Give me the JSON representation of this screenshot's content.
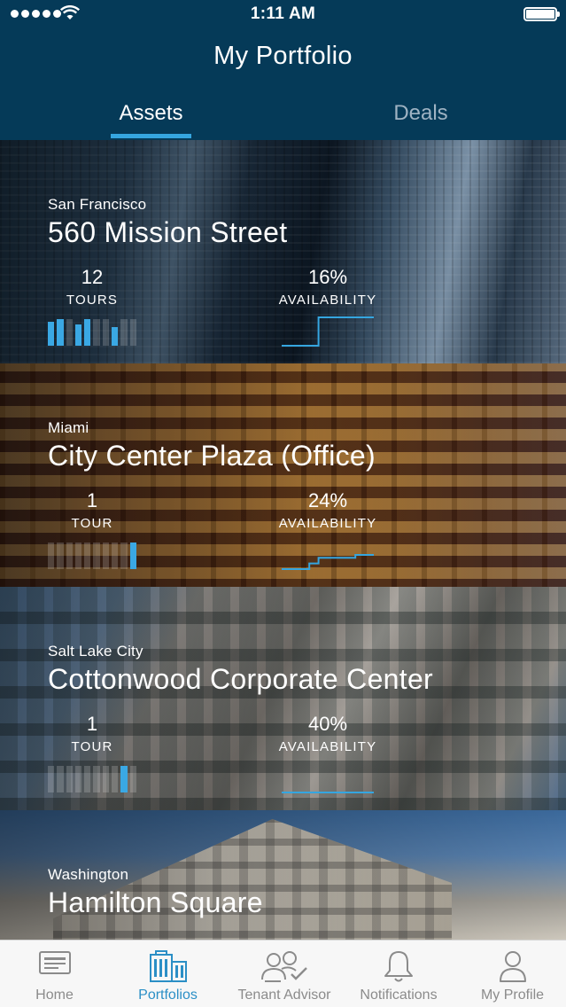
{
  "status_bar": {
    "time": "1:11 AM"
  },
  "header": {
    "title": "My Portfolio"
  },
  "tabs": [
    {
      "label": "Assets",
      "selected": true
    },
    {
      "label": "Deals",
      "selected": false
    }
  ],
  "properties": [
    {
      "city": "San Francisco",
      "name": "560 Mission Street",
      "tours": "12",
      "tours_label": "TOURS",
      "availability": "16%",
      "availability_label": "AVAILABILITY",
      "tour_bars": [
        0.9,
        1,
        0,
        0.8,
        1,
        0,
        0,
        0.7,
        0,
        0
      ],
      "availability_trend": [
        0,
        0,
        0,
        0,
        1,
        1,
        1,
        1,
        1,
        1
      ]
    },
    {
      "city": "Miami",
      "name": "City Center Plaza (Office)",
      "tours": "1",
      "tours_label": "TOUR",
      "availability": "24%",
      "availability_label": "AVAILABILITY",
      "tour_bars": [
        0,
        0,
        0,
        0,
        0,
        0,
        0,
        0,
        0,
        1
      ],
      "availability_trend": [
        0,
        0,
        0,
        0.2,
        0.4,
        0.4,
        0.4,
        0.4,
        0.5,
        0.5
      ]
    },
    {
      "city": "Salt Lake City",
      "name": "Cottonwood Corporate Center",
      "tours": "1",
      "tours_label": "TOUR",
      "availability": "40%",
      "availability_label": "AVAILABILITY",
      "tour_bars": [
        0,
        0,
        0,
        0,
        0,
        0,
        0,
        0,
        1,
        0
      ],
      "availability_trend": [
        0,
        0,
        0,
        0,
        0,
        0,
        0,
        0,
        0,
        0
      ]
    },
    {
      "city": "Washington",
      "name": "Hamilton Square"
    }
  ],
  "tabbar": [
    {
      "label": "Home",
      "icon": "home-icon",
      "active": false
    },
    {
      "label": "Portfolios",
      "icon": "building-icon",
      "active": true
    },
    {
      "label": "Tenant Advisor",
      "icon": "people-check-icon",
      "active": false
    },
    {
      "label": "Notifications",
      "icon": "bell-icon",
      "active": false
    },
    {
      "label": "My Profile",
      "icon": "person-icon",
      "active": false
    }
  ],
  "colors": {
    "header_bg": "#053a58",
    "accent": "#35a6e0",
    "tab_inactive": "#9fb3c3"
  }
}
